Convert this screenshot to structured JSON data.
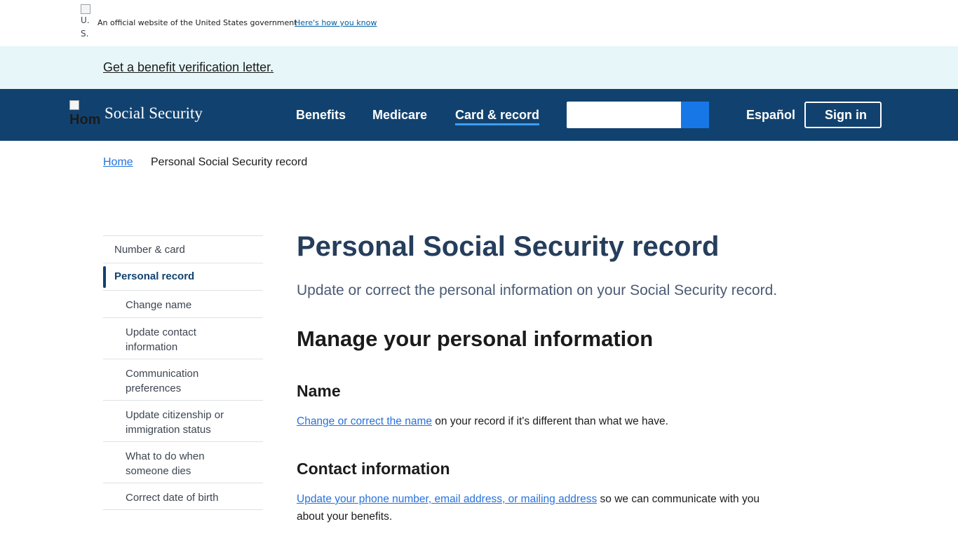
{
  "gov_banner": {
    "flag_alt": "U.S. flag",
    "text": "An official website of the United States government",
    "link": "Here's how you know"
  },
  "alert": {
    "link": "Get a benefit verification letter."
  },
  "header": {
    "logo_alt": "Home",
    "brand": "Social Security",
    "nav": [
      "Benefits",
      "Medicare",
      "Card & record"
    ],
    "active_nav": "Card & record",
    "search_placeholder": "",
    "language": "Español",
    "signin": "Sign in",
    "colors": {
      "header_bg": "#11426f",
      "search_button": "#1877e6",
      "active_underline": "#3d9dff"
    }
  },
  "breadcrumb": {
    "home": "Home",
    "current": "Personal Social Security record"
  },
  "sidenav": {
    "top_item": "Number & card",
    "active_item": "Personal record",
    "sub_items": [
      "Change name",
      "Update contact information",
      "Communication preferences",
      "Update citizenship or immigration status",
      "What to do when someone dies",
      "Correct date of birth"
    ]
  },
  "main": {
    "title": "Personal Social Security record",
    "lead": "Update or correct the personal information on your Social Security record.",
    "section_title": "Manage your personal information",
    "name": {
      "heading": "Name",
      "link": "Change or correct the name",
      "text": " on your record if it's different than what we have."
    },
    "contact": {
      "heading": "Contact information",
      "link": "Update your phone number, email address, or mailing address",
      "text": " so we can communicate with you about your benefits."
    }
  }
}
